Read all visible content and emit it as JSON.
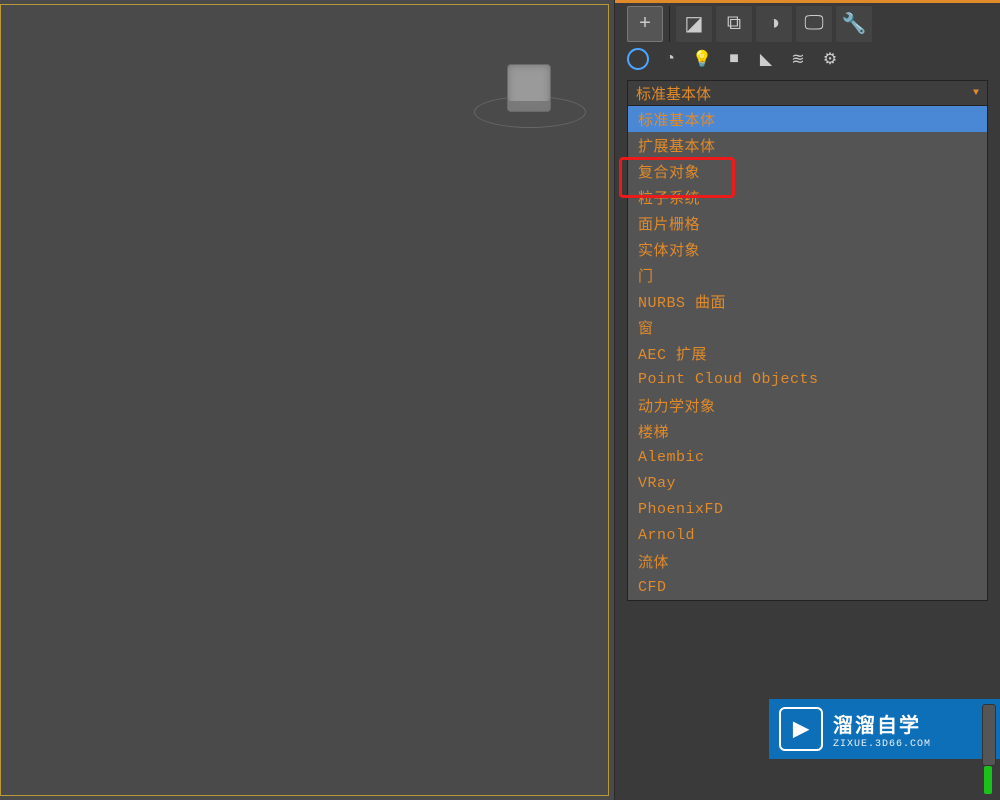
{
  "toolbar_row1": [
    {
      "name": "create-tab-icon",
      "glyph": "+"
    },
    {
      "name": "modify-tab-icon",
      "glyph": "◪"
    },
    {
      "name": "hierarchy-tab-icon",
      "glyph": "⧉"
    },
    {
      "name": "motion-tab-icon",
      "glyph": "◑"
    },
    {
      "name": "display-tab-icon",
      "glyph": "🖵"
    },
    {
      "name": "utilities-tab-icon",
      "glyph": "🔧"
    }
  ],
  "subbar_icons": [
    {
      "name": "geometry-icon",
      "glyph": ""
    },
    {
      "name": "shapes-icon",
      "glyph": "◔"
    },
    {
      "name": "lights-icon",
      "glyph": "💡"
    },
    {
      "name": "cameras-icon",
      "glyph": "■"
    },
    {
      "name": "helpers-icon",
      "glyph": "◣"
    },
    {
      "name": "spacewarps-icon",
      "glyph": "≋"
    },
    {
      "name": "systems-icon",
      "glyph": "⚙"
    }
  ],
  "dropdown": {
    "selected": "标准基本体",
    "options": [
      {
        "label": "标准基本体",
        "highlight": true
      },
      {
        "label": "扩展基本体"
      },
      {
        "label": "复合对象"
      },
      {
        "label": "粒子系统"
      },
      {
        "label": "面片栅格"
      },
      {
        "label": "实体对象"
      },
      {
        "label": "门"
      },
      {
        "label": "NURBS 曲面"
      },
      {
        "label": "窗"
      },
      {
        "label": "AEC 扩展"
      },
      {
        "label": "Point Cloud Objects"
      },
      {
        "label": "动力学对象"
      },
      {
        "label": "楼梯"
      },
      {
        "label": "Alembic"
      },
      {
        "label": "VRay"
      },
      {
        "label": "PhoenixFD"
      },
      {
        "label": "Arnold"
      },
      {
        "label": "流体"
      },
      {
        "label": "CFD"
      }
    ]
  },
  "annotation": {
    "highlighted_option": "扩展基本体"
  },
  "watermark": {
    "title": "溜溜自学",
    "subtitle": "ZIXUE.3D66.COM"
  }
}
